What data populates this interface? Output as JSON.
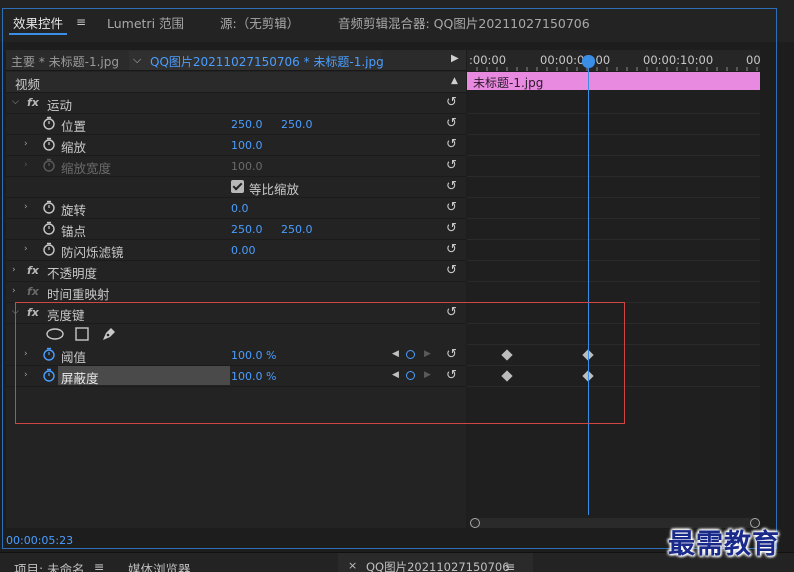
{
  "tabs": [
    {
      "label": "效果控件",
      "active": true
    },
    {
      "label": "Lumetri 范围"
    },
    {
      "label": "源:（无剪辑）"
    },
    {
      "label": "音频剪辑混合器: QQ图片20211027150706"
    }
  ],
  "menu_icon": "≡",
  "source": {
    "master": "主要 * 未标题-1.jpg",
    "clip": "QQ图片20211027150706 * 未标题-1.jpg"
  },
  "section_video": "视频",
  "effects": {
    "motion": {
      "label": "运动",
      "position": {
        "label": "位置",
        "x": "250.0",
        "y": "250.0"
      },
      "scale": {
        "label": "缩放",
        "value": "100.0"
      },
      "scale_width": {
        "label": "缩放宽度",
        "value": "100.0"
      },
      "uniform_scale": {
        "label": "等比缩放",
        "checked": true
      },
      "rotation": {
        "label": "旋转",
        "value": "0.0"
      },
      "anchor": {
        "label": "锚点",
        "x": "250.0",
        "y": "250.0"
      },
      "anti_flicker": {
        "label": "防闪烁滤镜",
        "value": "0.00"
      }
    },
    "opacity": {
      "label": "不透明度"
    },
    "time_remap": {
      "label": "时间重映射"
    },
    "luma_key": {
      "label": "亮度键",
      "threshold": {
        "label": "阈值",
        "value": "100.0 %"
      },
      "cutoff": {
        "label": "屏蔽度",
        "value": "100.0 %"
      }
    }
  },
  "timeline": {
    "labels": [
      ":00:00",
      "00:00:05:00",
      "00:00:10:00",
      "00"
    ],
    "clip": "未标题-1.jpg"
  },
  "timecode": "00:00:05:23",
  "bottom_tabs": {
    "project": "项目: 未命名",
    "media_browser": "媒体浏览器",
    "sequence": "QQ图片20211027150706"
  },
  "watermark": "最需教育",
  "colors": {
    "accent": "#3a8ee6",
    "value_blue": "#4a9eff",
    "clip_pink": "#e88ae0",
    "selection_red": "#d24545"
  }
}
